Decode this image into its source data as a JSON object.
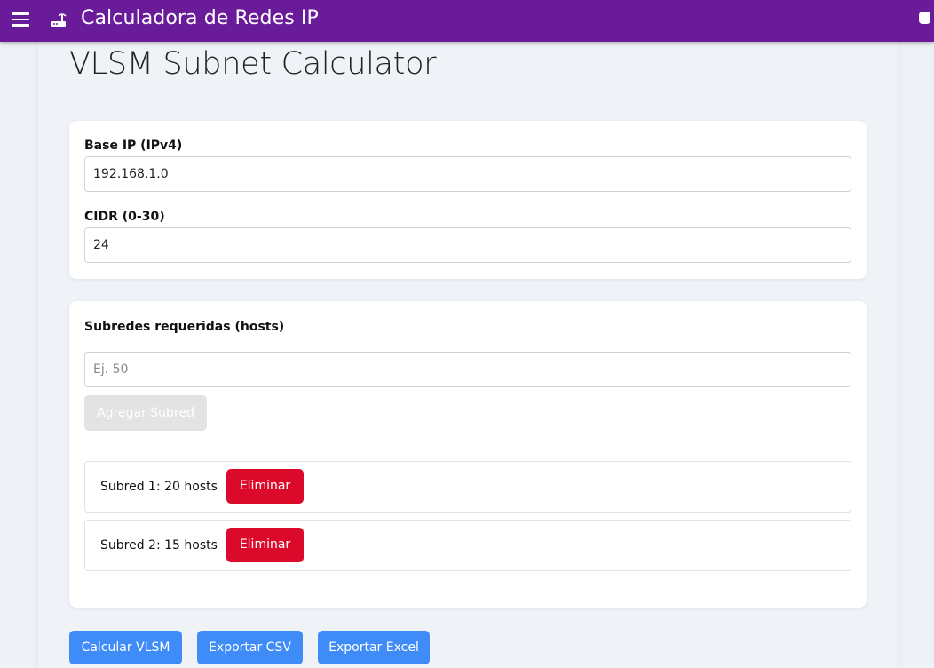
{
  "topbar": {
    "title": "Calculadora de Redes IP",
    "menu_icon": "hamburger-menu-icon",
    "brand_icon": "router-icon",
    "accent_color": "#6a1b9a"
  },
  "page": {
    "title": "VLSM Subnet Calculator"
  },
  "network_form": {
    "base_ip_label": "Base IP (IPv4)",
    "base_ip_value": "192.168.1.0",
    "cidr_label": "CIDR (0-30)",
    "cidr_value": "24"
  },
  "subnets": {
    "heading": "Subredes requeridas (hosts)",
    "input_placeholder": "Ej. 50",
    "add_button": "Agregar Subred",
    "items": [
      {
        "text": "Subred 1: 20 hosts",
        "delete_label": "Eliminar"
      },
      {
        "text": "Subred 2: 15 hosts",
        "delete_label": "Eliminar"
      }
    ],
    "delete_color": "#dc0a2a"
  },
  "actions": {
    "calculate": "Calcular VLSM",
    "export_csv": "Exportar CSV",
    "export_excel": "Exportar Excel",
    "button_color": "#3f8cf8"
  }
}
